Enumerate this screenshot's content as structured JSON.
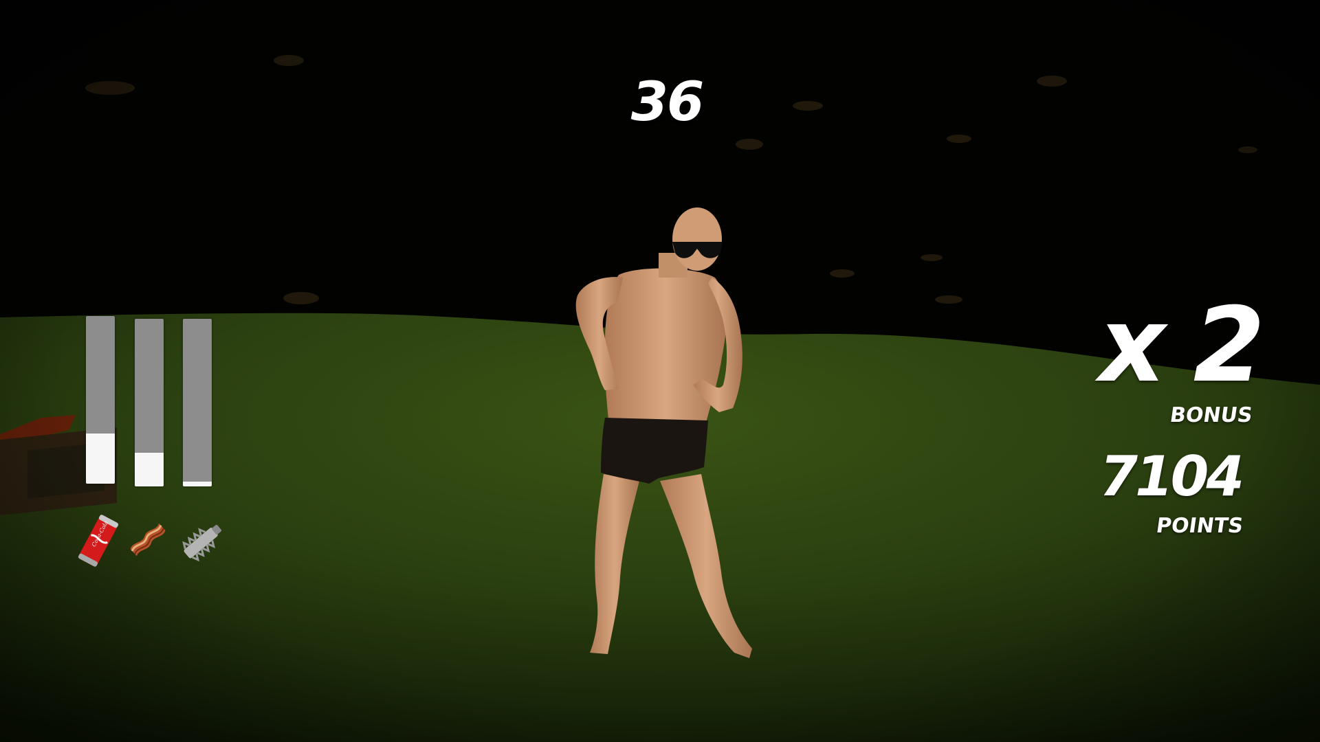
{
  "hud": {
    "timer": "36",
    "multiplier": "x 2",
    "bonus_label": "BONUS",
    "points": "7104",
    "points_label": "POINTS"
  },
  "meters": [
    {
      "item": "cola-can-icon",
      "fill": 0.3
    },
    {
      "item": "bacon-icon",
      "fill": 0.2
    },
    {
      "item": "wall-plug-icon",
      "fill": 0.03
    }
  ],
  "items": [
    {
      "icon": "cola-can-icon",
      "label": "Coca-Cola"
    },
    {
      "icon": "bacon-icon"
    },
    {
      "icon": "wall-plug-icon"
    }
  ],
  "colors": {
    "sky": "#020201",
    "grass": "#2f4412",
    "hud_text": "#ffffff",
    "meter_empty": "#8d8d8d",
    "meter_fill": "#f6f6f6"
  }
}
